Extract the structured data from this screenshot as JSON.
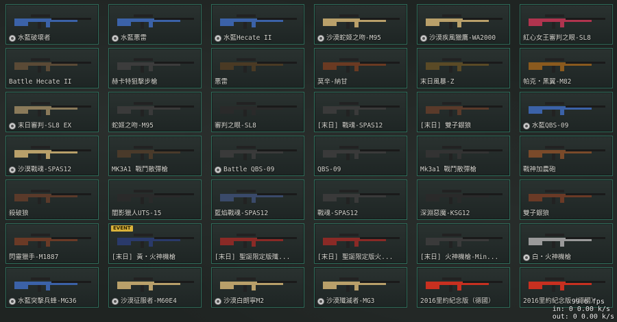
{
  "cards": [
    {
      "name": "水藍破壞者",
      "badge": true,
      "color": "#3b62a8"
    },
    {
      "name": "水藍悪雷",
      "badge": true,
      "color": "#3b62a8"
    },
    {
      "name": "水藍Hecate II",
      "badge": true,
      "color": "#3b62a8"
    },
    {
      "name": "沙漠蛇姬之吻-M95",
      "badge": true,
      "color": "#b9a06a"
    },
    {
      "name": "沙漠疾風獵鷹-WA2000",
      "badge": true,
      "color": "#b9a06a"
    },
    {
      "name": "紅心女王審判之眼-SL8",
      "badge": false,
      "color": "#b0344e"
    },
    {
      "name": "Battle Hecate II",
      "badge": false,
      "color": "#5a4a36"
    },
    {
      "name": "赫卡特狙擊步槍",
      "badge": false,
      "color": "#3c3c3c"
    },
    {
      "name": "悪雷",
      "badge": false,
      "color": "#4a3a24"
    },
    {
      "name": "莫辛-納甘",
      "badge": false,
      "color": "#6a3a22"
    },
    {
      "name": "末日風暴-Z",
      "badge": false,
      "color": "#5a4a26"
    },
    {
      "name": "帕克・黑翼-M82",
      "badge": false,
      "color": "#8a5a1e"
    },
    {
      "name": "末日審判-SL8 EX",
      "badge": true,
      "color": "#8a7a5a"
    },
    {
      "name": "蛇姬之吻-M95",
      "badge": false,
      "color": "#3a3a3a"
    },
    {
      "name": "審判之眼-SL8",
      "badge": false,
      "color": "#2a2a2a"
    },
    {
      "name": "[末日] 戰魂-SPAS12",
      "badge": false,
      "color": "#3a3a3a"
    },
    {
      "name": "[末日] 雙子銀狼",
      "badge": false,
      "color": "#5a3a2a"
    },
    {
      "name": "水藍QBS-09",
      "badge": true,
      "color": "#3b62a8"
    },
    {
      "name": "沙漠戰魂-SPAS12",
      "badge": true,
      "color": "#b9a06a"
    },
    {
      "name": "MK3A1 戰鬥散彈槍",
      "badge": false,
      "color": "#4a3a2a"
    },
    {
      "name": "Battle QBS-09",
      "badge": true,
      "color": "#3a3a3a"
    },
    {
      "name": "QBS-09",
      "badge": false,
      "color": "#3a3a3a"
    },
    {
      "name": "Mk3a1 戰鬥散彈槍",
      "badge": false,
      "color": "#333333"
    },
    {
      "name": "戰神加農砲",
      "badge": false,
      "color": "#7a4a2a"
    },
    {
      "name": "殺破狼",
      "badge": false,
      "color": "#5a3a2a"
    },
    {
      "name": "闇影獵人UTS-15",
      "badge": false,
      "color": "#2a2a2a"
    },
    {
      "name": "藍焰戰魂-SPAS12",
      "badge": false,
      "color": "#3a4a6a"
    },
    {
      "name": "戰魂-SPAS12",
      "badge": false,
      "color": "#3a3a3a"
    },
    {
      "name": "深淵惡魔-KSG12",
      "badge": false,
      "color": "#2a2a2a"
    },
    {
      "name": "雙子銀狼",
      "badge": false,
      "color": "#6a3a26"
    },
    {
      "name": "閃靈獵手-M1887",
      "badge": false,
      "color": "#6a3a26"
    },
    {
      "name": "[末日] 黃・火神機槍",
      "badge": false,
      "color": "#2a3a6a",
      "event": "EVENT"
    },
    {
      "name": "[末日] 聖誕限定版殲...",
      "badge": false,
      "color": "#8a2a26"
    },
    {
      "name": "[末日] 聖誕限定版火...",
      "badge": false,
      "color": "#8a2a26"
    },
    {
      "name": "[末日] 火神機槍-Min...",
      "badge": false,
      "color": "#3a3a3a"
    },
    {
      "name": "白・火神機槍",
      "badge": true,
      "color": "#9a9a9a"
    },
    {
      "name": "水藍突擊兵蜂-MG36",
      "badge": true,
      "color": "#3b62a8"
    },
    {
      "name": "沙漠征服者-M60E4",
      "badge": true,
      "color": "#b9a06a"
    },
    {
      "name": "沙漠白朗寧M2",
      "badge": true,
      "color": "#b9a06a"
    },
    {
      "name": "沙漠殲滅者-MG3",
      "badge": true,
      "color": "#b9a06a"
    },
    {
      "name": "2016里約紀念版（德國）",
      "badge": false,
      "color": "#c83020"
    },
    {
      "name": "2016里約紀念版（德國）",
      "badge": false,
      "color": "#c83020"
    }
  ],
  "overlay": {
    "fps": "99.6 fps",
    "in": "in:  0 0.00 k/s",
    "out": "out: 0 0.00 k/s"
  }
}
